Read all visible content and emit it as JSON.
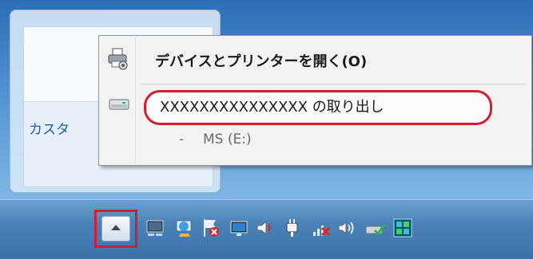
{
  "flyout": {
    "customize_text": "カスタ"
  },
  "context_menu": {
    "items": [
      {
        "label": "デバイスとプリンターを開く(O)",
        "icon": "printer-icon"
      },
      {
        "label": "XXXXXXXXXXXXXXX の取り出し",
        "icon": "drive-icon",
        "highlighted": true
      },
      {
        "dash": "-",
        "label": "MS (E:)"
      }
    ]
  },
  "taskbar": {
    "show_hidden_icons": {
      "icon": "chevron-up-icon",
      "highlighted": true
    },
    "tray_icons": [
      "network-display-icon",
      "intel-graphics-icon",
      "action-center-flag-icon",
      "network-monitor-icon",
      "speaker-icon",
      "power-plug-icon",
      "network-disconnected-icon",
      "volume-icon",
      "usb-safely-remove-icon",
      "app-grid-icon"
    ]
  },
  "colors": {
    "highlight_border": "#d11f32",
    "menu_background": "#f3f3f3",
    "taskbar": "#4a82b8",
    "desktop": "#4f91d0"
  }
}
